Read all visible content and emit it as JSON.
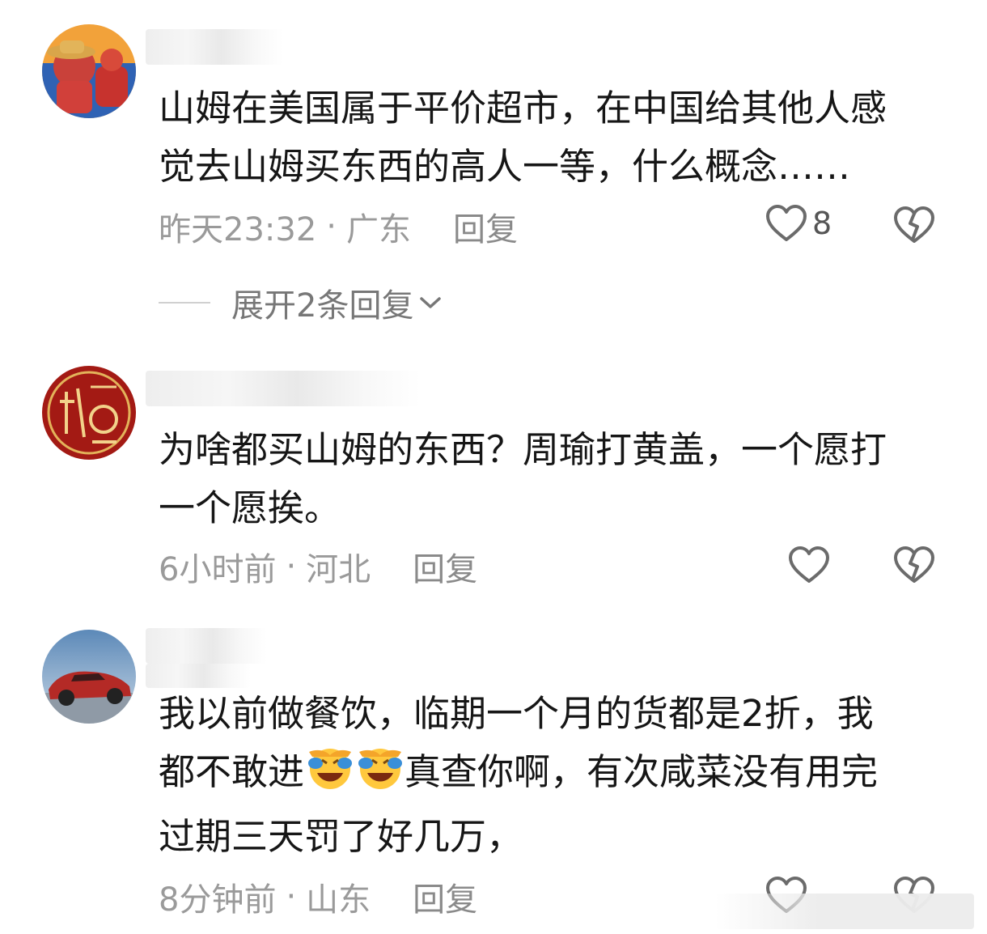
{
  "comments": [
    {
      "text_line1": "山姆在美国属于平价超市，在中国给其他人感",
      "text_line2": "觉去山姆买东西的高人一等，什么概念……",
      "time": "昨天23:32",
      "location": "广东",
      "reply_label": "回复",
      "like_count": "8",
      "expand_label": "展开2条回复"
    },
    {
      "text_line1": "为啥都买山姆的东西？周瑜打黄盖，一个愿打",
      "text_line2": "一个愿挨。",
      "time": "6小时前",
      "location": "河北",
      "reply_label": "回复"
    },
    {
      "text_line1": "我以前做餐饮，临期一个月的货都是2折，我",
      "text_line2a": "都不敢进",
      "text_line2b": "真查你啊，有次咸菜没有用完",
      "text_line3": "过期三天罚了好几万，",
      "time": "8分钟前",
      "location": "山东",
      "reply_label": "回复"
    }
  ],
  "separator": "·",
  "icons": {
    "like": "heart-outline-icon",
    "dislike": "broken-heart-icon",
    "expand": "chevron-down-icon",
    "emoji": "face-with-hand-over-mouth-laughing-emoji"
  },
  "colors": {
    "text": "#161616",
    "meta": "#9a9a9a",
    "icon": "#6b6b6b"
  }
}
